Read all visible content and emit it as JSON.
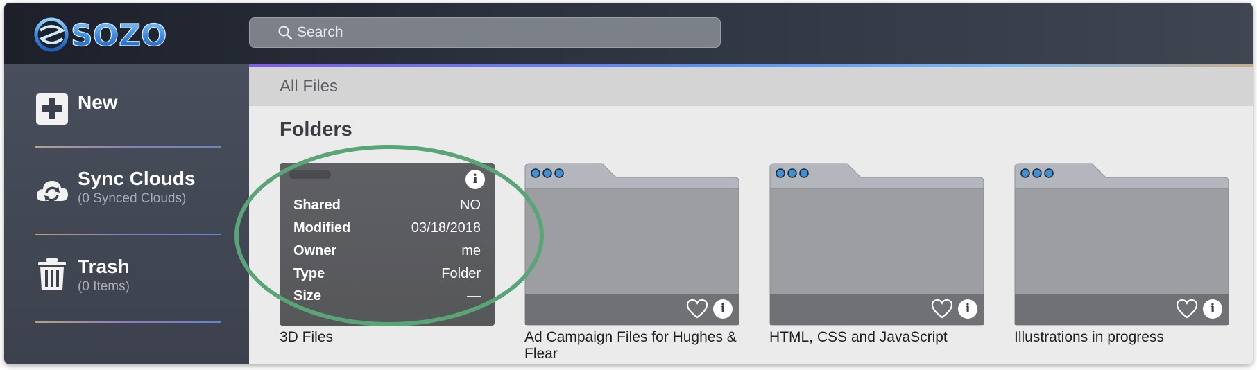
{
  "app": {
    "brand": "SOZO"
  },
  "search": {
    "placeholder": "Search"
  },
  "sidebar": {
    "items": [
      {
        "label": "New",
        "sub": ""
      },
      {
        "label": "Sync Clouds",
        "sub": "(0 Synced Clouds)"
      },
      {
        "label": "Trash",
        "sub": "(0 Items)"
      }
    ]
  },
  "main": {
    "breadcrumb": "All Files",
    "section_title": "Folders",
    "folders": [
      {
        "name": "3D Files",
        "info": [
          {
            "key": "Shared",
            "value": "NO"
          },
          {
            "key": "Modified",
            "value": "03/18/2018"
          },
          {
            "key": "Owner",
            "value": "me"
          },
          {
            "key": "Type",
            "value": "Folder"
          },
          {
            "key": "Size",
            "value": "—"
          }
        ]
      },
      {
        "name": "Ad Campaign Files for Hughes & Flear"
      },
      {
        "name": "HTML, CSS and JavaScript"
      },
      {
        "name": "Illustrations in progress"
      }
    ]
  },
  "colors": {
    "highlight": "#5aa577",
    "accent_start": "#7d5fd6",
    "accent_end": "#7db6ea",
    "folder_dots": "#3f8fd4"
  },
  "icons": {
    "search": "search-icon",
    "new": "plus-square-icon",
    "sync": "cloud-sync-icon",
    "trash": "trash-icon",
    "favorite": "heart-icon",
    "info": "info-icon"
  }
}
